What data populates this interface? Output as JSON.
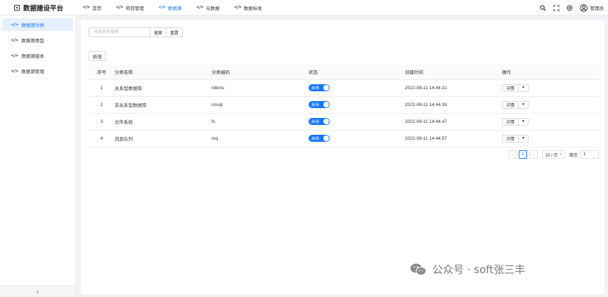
{
  "app": {
    "title": "数据建设平台"
  },
  "topnav": [
    {
      "label": "首页"
    },
    {
      "label": "项目管理"
    },
    {
      "label": "数据源"
    },
    {
      "label": "元数据"
    },
    {
      "label": "数据标准"
    }
  ],
  "header": {
    "user": "管理员"
  },
  "sidebar": {
    "items": [
      {
        "label": "数据源分类"
      },
      {
        "label": "数据源类型"
      },
      {
        "label": "数据源版本"
      },
      {
        "label": "数据源管理"
      }
    ],
    "collapse_glyph": "‹"
  },
  "search": {
    "placeholder": "分类名称搜索",
    "search_label": "搜索",
    "reset_label": "重置"
  },
  "toolbar": {
    "add_label": "新增"
  },
  "table": {
    "headers": [
      "序号",
      "分类名称",
      "分类编码",
      "状态",
      "创建时间",
      "操作"
    ],
    "rows": [
      {
        "index": "1",
        "name": "关系型数据库",
        "code": "rdbms",
        "status": "启用",
        "created": "2022-08-11 14:44:31",
        "action": "详情"
      },
      {
        "index": "2",
        "name": "非关系型数据库",
        "code": "nosql",
        "status": "启用",
        "created": "2022-08-11 14:44:39",
        "action": "详情"
      },
      {
        "index": "3",
        "name": "文件系统",
        "code": "fs",
        "status": "启用",
        "created": "2022-08-11 14:44:47",
        "action": "详情"
      },
      {
        "index": "4",
        "name": "消息队列",
        "code": "mq",
        "status": "启用",
        "created": "2022-08-11 14:44:57",
        "action": "详情"
      }
    ]
  },
  "pagination": {
    "current": "1",
    "page_size": "10 / 页",
    "jump_label": "跳至",
    "jump_value": "1"
  },
  "watermark": {
    "text": "公众号 · soft张三丰"
  },
  "colors": {
    "primary": "#1677ff",
    "page_bg": "#f0f2f5"
  }
}
